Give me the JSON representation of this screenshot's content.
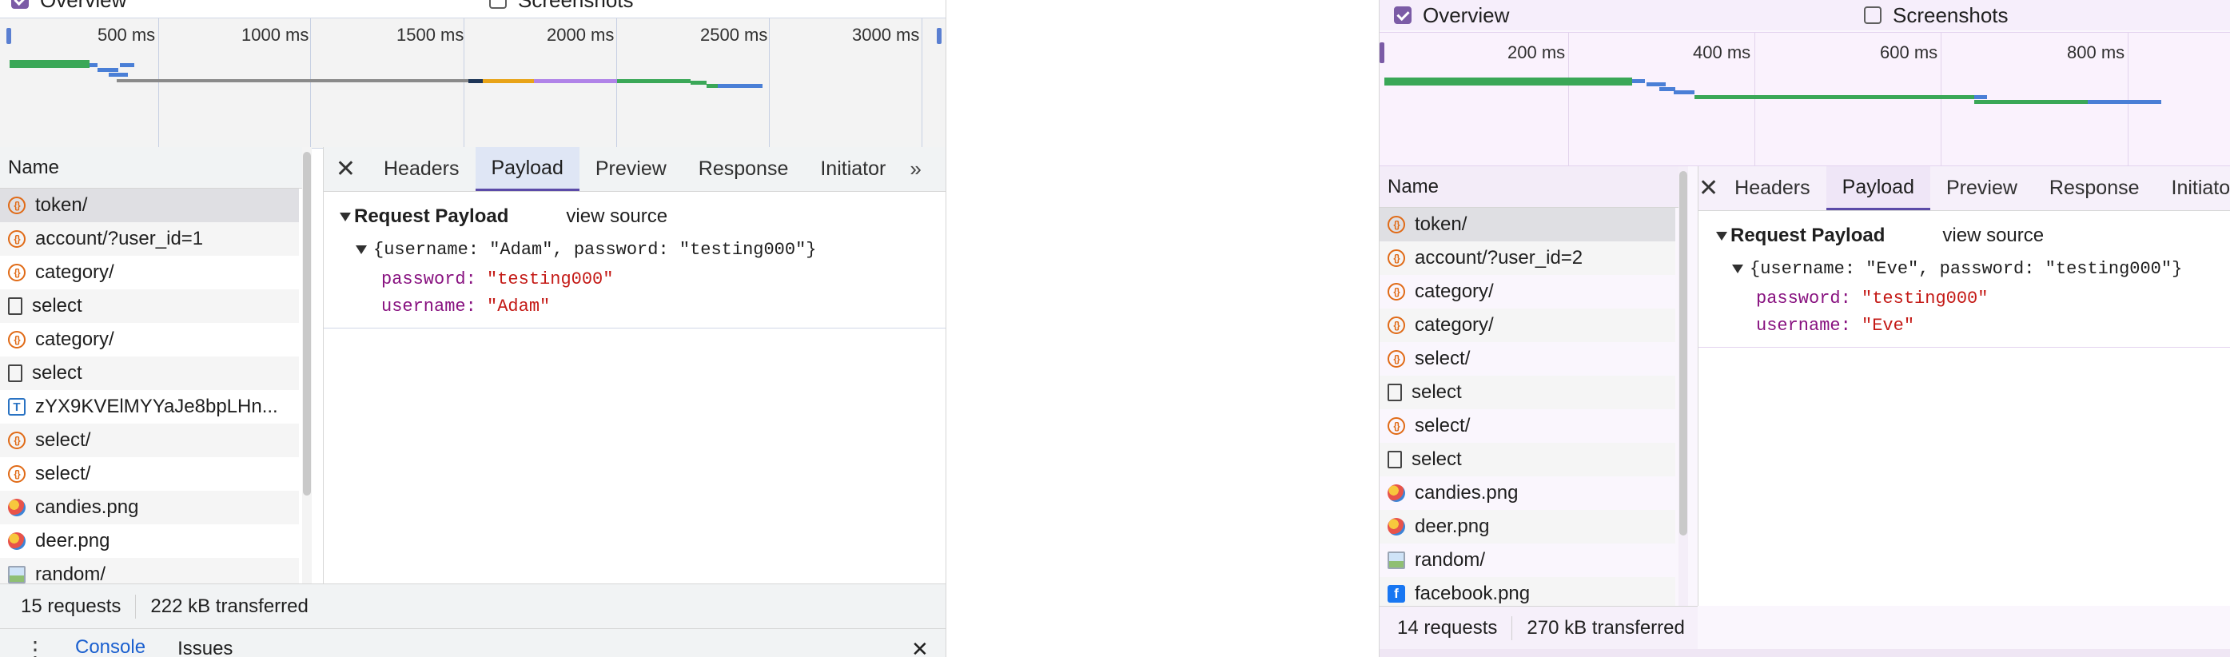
{
  "left": {
    "overview_label": "Overview",
    "screenshots_label": "Screenshots",
    "ticks": [
      "500 ms",
      "1000 ms",
      "1500 ms",
      "2000 ms",
      "2500 ms",
      "3000 ms"
    ],
    "name_header": "Name",
    "requests": [
      {
        "name": "token/",
        "icon": "json-icon"
      },
      {
        "name": "account/?user_id=1",
        "icon": "json-icon"
      },
      {
        "name": "category/",
        "icon": "json-icon"
      },
      {
        "name": "select",
        "icon": "document-icon"
      },
      {
        "name": "category/",
        "icon": "json-icon"
      },
      {
        "name": "select",
        "icon": "document-icon"
      },
      {
        "name": "zYX9KVElMYYaJe8bpLHn...",
        "icon": "font-icon"
      },
      {
        "name": "select/",
        "icon": "json-icon"
      },
      {
        "name": "select/",
        "icon": "json-icon"
      },
      {
        "name": "candies.png",
        "icon": "image-icon"
      },
      {
        "name": "deer.png",
        "icon": "image-icon"
      },
      {
        "name": "random/",
        "icon": "picture-icon"
      }
    ],
    "tabs": [
      "Headers",
      "Payload",
      "Preview",
      "Response",
      "Initiator"
    ],
    "payload_title": "Request Payload",
    "view_source": "view source",
    "payload_summary": "{username: \"Adam\", password: \"testing000\"}",
    "fields": [
      {
        "key": "password",
        "value": "\"testing000\""
      },
      {
        "key": "username",
        "value": "\"Adam\""
      }
    ],
    "requests_count": "15 requests",
    "transferred": "222 kB transferred",
    "drawer_tabs": [
      "Console",
      "Issues"
    ]
  },
  "right": {
    "overview_label": "Overview",
    "screenshots_label": "Screenshots",
    "ticks": [
      "200 ms",
      "400 ms",
      "600 ms",
      "800 ms"
    ],
    "name_header": "Name",
    "requests": [
      {
        "name": "token/",
        "icon": "json-icon"
      },
      {
        "name": "account/?user_id=2",
        "icon": "json-icon"
      },
      {
        "name": "category/",
        "icon": "json-icon"
      },
      {
        "name": "category/",
        "icon": "json-icon"
      },
      {
        "name": "select/",
        "icon": "json-icon"
      },
      {
        "name": "select",
        "icon": "document-icon"
      },
      {
        "name": "select/",
        "icon": "json-icon"
      },
      {
        "name": "select",
        "icon": "document-icon"
      },
      {
        "name": "candies.png",
        "icon": "image-icon"
      },
      {
        "name": "deer.png",
        "icon": "image-icon"
      },
      {
        "name": "random/",
        "icon": "picture-icon"
      },
      {
        "name": "facebook.png",
        "icon": "facebook-icon"
      }
    ],
    "tabs": [
      "Headers",
      "Payload",
      "Preview",
      "Response",
      "Initiator"
    ],
    "payload_title": "Request Payload",
    "view_source": "view source",
    "payload_summary": "{username: \"Eve\", password: \"testing000\"}",
    "fields": [
      {
        "key": "password",
        "value": "\"testing000\""
      },
      {
        "key": "username",
        "value": "\"Eve\""
      }
    ],
    "requests_count": "14 requests",
    "transferred": "270 kB transferred"
  },
  "colors": {
    "accent": "#5b4aa8",
    "checkbox": "#7b5ba6",
    "waterfall_green": "#3aa757",
    "waterfall_blue": "#4a7fd6",
    "json_icon": "#e06a16",
    "string_value": "#c41a16",
    "property_key": "#881280"
  }
}
